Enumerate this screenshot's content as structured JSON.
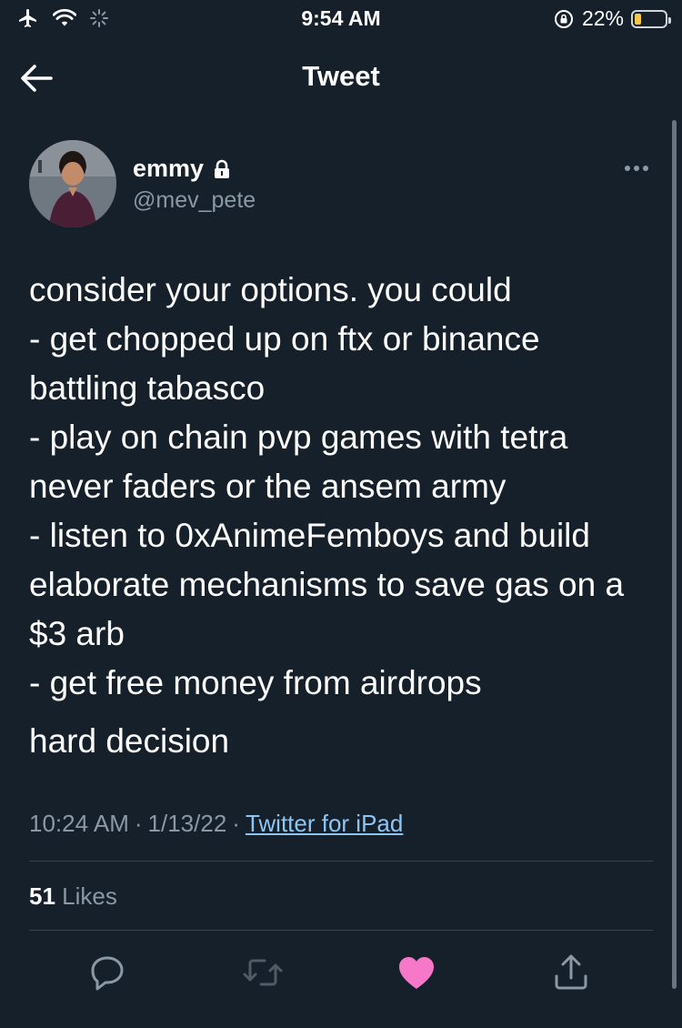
{
  "status_bar": {
    "time": "9:54 AM",
    "battery_text": "22%",
    "battery_level": 0.22
  },
  "nav": {
    "title": "Tweet"
  },
  "author": {
    "name": "emmy",
    "handle": "@mev_pete"
  },
  "tweet": {
    "text": "consider your options. you could\n- get chopped up on ftx or binance battling tabasco\n- play on chain pvp games with tetra never faders or the ansem army\n- listen to 0xAnimeFemboys and build elaborate mechanisms to save gas on a $3 arb\n- get free money from airdrops",
    "text2": "hard decision",
    "time": "10:24 AM",
    "sep1": "·",
    "date": "1/13/22",
    "sep2": "·",
    "source": "Twitter for iPad"
  },
  "stats": {
    "likes_count": "51",
    "likes_label": "Likes"
  },
  "colors": {
    "background": "#15202b",
    "secondary_text": "#8b98a5",
    "link": "#8ec5f3",
    "like_pink": "#f91880"
  },
  "icons": [
    "airplane-icon",
    "wifi-icon",
    "activity-icon",
    "orientation-lock-icon",
    "battery-icon",
    "back-arrow-icon",
    "lock-icon",
    "more-icon",
    "reply-icon",
    "retweet-icon",
    "like-icon",
    "share-icon"
  ]
}
